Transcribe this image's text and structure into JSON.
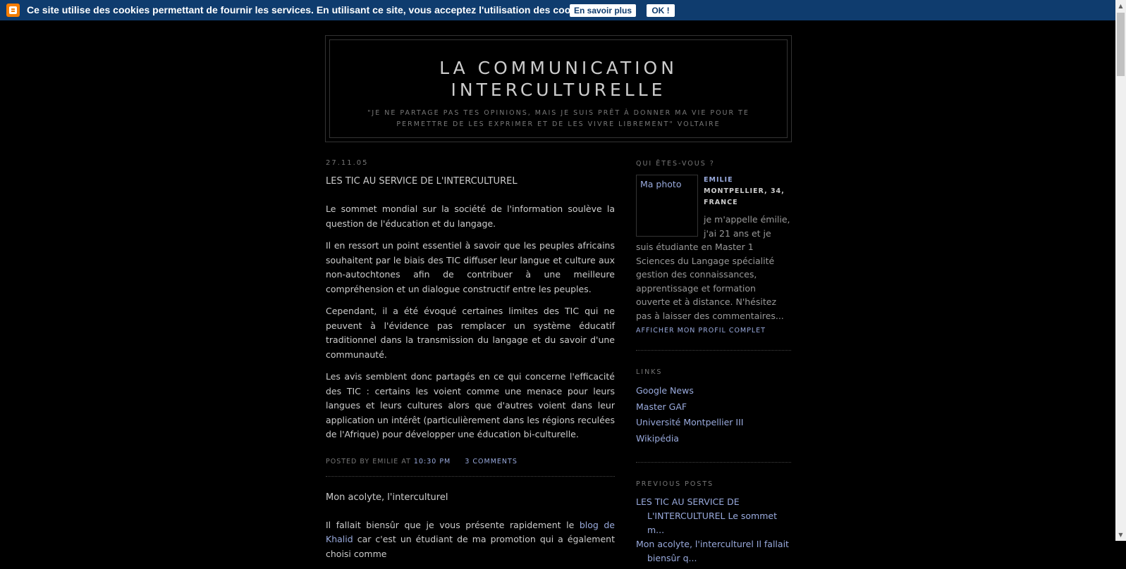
{
  "cookie_bar": {
    "text": "Ce site utilise des cookies permettant de fournir les services. En utilisant ce site, vous acceptez l'utilisation des cookies.",
    "learn_more": "En savoir plus",
    "ok": "OK !",
    "logo": "blogger-icon",
    "bg_color": "#0f3c6e"
  },
  "header": {
    "title": "LA COMMUNICATION INTERCULTURELLE",
    "description": "\"JE NE PARTAGE PAS TES OPINIONS, MAIS JE SUIS PRÊT À DONNER MA VIE POUR TE PERMETTRE DE LES EXPRIMER ET DE LES VIVRE LIBREMENT\" VOLTAIRE"
  },
  "post1": {
    "date": "27.11.05",
    "title": "LES TIC AU SERVICE DE L'INTERCULTUREL",
    "paragraphs": [
      "Le sommet mondial sur la société de l'information soulève la question de l'éducation et du langage.",
      "Il en ressort un point essentiel à savoir que les peuples africains souhaitent par le biais des TIC diffuser leur langue et culture aux non-autochtones afin de contribuer à une meilleure compréhension et un dialogue constructif entre les peuples.",
      "Cependant, il a été évoqué certaines limites des TIC qui ne peuvent à l'évidence pas remplacer un système éducatif traditionnel dans la transmission du langage et du savoir d'une communauté.",
      "Les avis semblent donc partagés en ce qui concerne l'efficacité des TIC : certains les voient comme une menace pour leurs langues et leurs cultures alors que d'autres voient dans leur application un intérêt (particulièrement dans les régions reculées de l'Afrique) pour développer une éducation bi-culturelle."
    ],
    "footer_prefix": "POSTED BY EMILIE AT",
    "time": "10:30 PM",
    "comments": "3 COMMENTS"
  },
  "post2": {
    "title": "Mon acolyte, l'interculturel",
    "text_before_link": "Il fallait biensûr que je vous présente rapidement le",
    "link": "blog de Khalid",
    "text_after_link": "car c'est un étudiant de ma promotion qui a également choisi comme"
  },
  "sidebar": {
    "about_heading": "QUI ÊTES-VOUS ?",
    "photo_label": "Ma photo",
    "name": "EMILIE",
    "location": "MONTPELLIER, 34, FRANCE",
    "bio": "je m'appelle émilie, j'ai 21 ans et je suis étudiante en Master 1 Sciences du Langage spécialité gestion des connaissances, apprentissage et formation ouverte et à distance. N'hésitez pas à laisser des commentaires...",
    "profile_link": "AFFICHER MON PROFIL COMPLET",
    "links_heading": "LINKS",
    "links": [
      "Google News",
      "Master GAF",
      "Université Montpellier III",
      "Wikipédia"
    ],
    "previous_heading": "PREVIOUS POSTS",
    "previous_posts": [
      "LES TIC AU SERVICE DE L'INTERCULTUREL Le sommet m...",
      "Mon acolyte, l'interculturel Il fallait biensûr q..."
    ]
  },
  "colors": {
    "background": "#000000",
    "text": "#cccccc",
    "muted": "#777777",
    "link": "#99aadd"
  }
}
